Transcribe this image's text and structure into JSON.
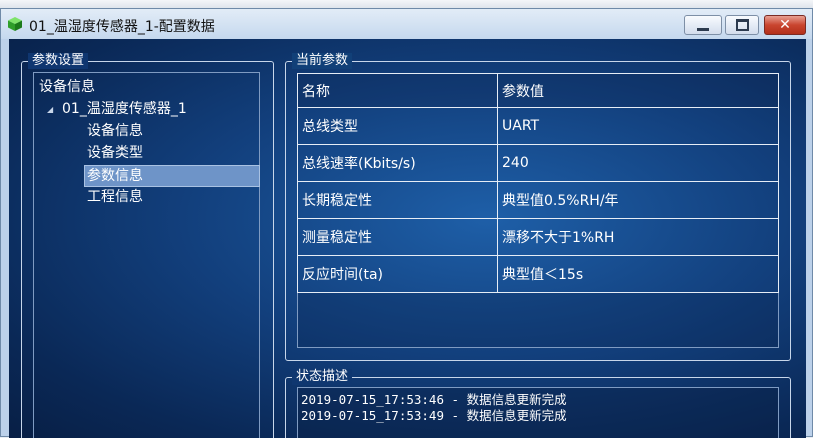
{
  "window": {
    "title": "01_温湿度传感器_1-配置数据",
    "min_icon": "minimize-icon",
    "max_icon": "maximize-icon",
    "close_icon": "close-icon",
    "close_glyph": "✕"
  },
  "params_group": {
    "title": "参数设置",
    "tree": {
      "root": "设备信息",
      "device": "01_温湿度传感器_1",
      "children": [
        "设备信息",
        "设备类型",
        "参数信息",
        "工程信息"
      ],
      "selected": "参数信息"
    }
  },
  "current_group": {
    "title": "当前参数",
    "headers": [
      "名称",
      "参数值"
    ],
    "rows": [
      {
        "name": "总线类型",
        "value": "UART"
      },
      {
        "name": "总线速率(Kbits/s)",
        "value": "240"
      },
      {
        "name": "长期稳定性",
        "value": "典型值0.5%RH/年"
      },
      {
        "name": "测量稳定性",
        "value": "漂移不大于1%RH"
      },
      {
        "name": "反应时间(ta)",
        "value": "典型值＜15s"
      }
    ]
  },
  "status_group": {
    "title": "状态描述",
    "log": [
      "2019-07-15_17:53:46 - 数据信息更新完成",
      "2019-07-15_17:53:49 - 数据信息更新完成"
    ]
  },
  "colors": {
    "client_bg": "#123f7c",
    "selection": "#6e94c8",
    "close_button": "#c9452f"
  }
}
